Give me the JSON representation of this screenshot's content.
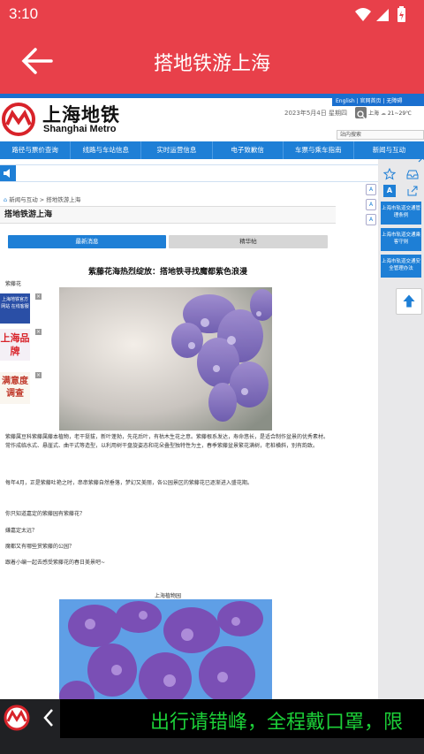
{
  "status_bar": {
    "time": "3:10"
  },
  "app_bar": {
    "title": "搭地铁游上海"
  },
  "site": {
    "top_links": "English | 官网首页 | 无障碍",
    "logo_cn": "上海地铁",
    "logo_en": "Shanghai Metro",
    "date": "2023年5月4日 星期四",
    "weather_city": "上海",
    "weather_temp": "21~29℃",
    "search_placeholder": "站内搜索",
    "nav": [
      "路径与票价查询",
      "线路与车站信息",
      "实时运营信息",
      "电子致歉信",
      "车票与乘车指南",
      "新闻与互动"
    ],
    "right_panel": {
      "buttons": [
        "上海市轨道交通管理条例",
        "上海市轨道交通乘客守则",
        "上海市轨道交通安全管理办法"
      ]
    },
    "font_sizes": [
      "A",
      "A",
      "A"
    ]
  },
  "content": {
    "breadcrumb": "新闻与互动  >  搭地铁游上海",
    "heading": "搭地铁游上海",
    "tabs": [
      "最新消息",
      "精华帖"
    ],
    "article_title": "紫藤花海热烈绽放：搭地铁寻找魔都紫色浪漫",
    "caption1": "紫藤花",
    "ads": [
      "上海地铁官方网站 在线客服",
      "上海品牌",
      "满意度调查"
    ],
    "ad_close": "×",
    "paragraph1": "紫藤属豆科紫藤属藤本植物，老干挺拔，新叶蓬勃，先花后叶，有枯木生花之意。紫藤根系发达，寿命悠长，是适合制作盆景的优秀素材。常作成临水式、悬崖式、曲干式等造型，以利用树干盘旋姿态和花朵叠型独特性为主，春季紫藤盆景繁花满树，老桩横斜，别有韵致。",
    "paragraph2": "每年4月，正是紫藤吐艳之时，串串紫藤自然垂落，梦幻又美丽，各公园景区的紫藤花已逐渐进入盛花期。",
    "q1": "你只知道嘉定的紫藤园有紫藤花？",
    "q2": "嫌嘉定太远？",
    "q3": "魔都又有哪些赏紫藤的公园？",
    "q4": "跟着小编一起去感受紫藤花的春日美景吧~",
    "caption2": "上海植物园"
  },
  "footer": {
    "ticker": "出行请错峰，全程戴口罩，限"
  },
  "colors": {
    "brand_red": "#e8404a",
    "metro_blue": "#1e7fd6",
    "ticker_green": "#1ccf38"
  }
}
